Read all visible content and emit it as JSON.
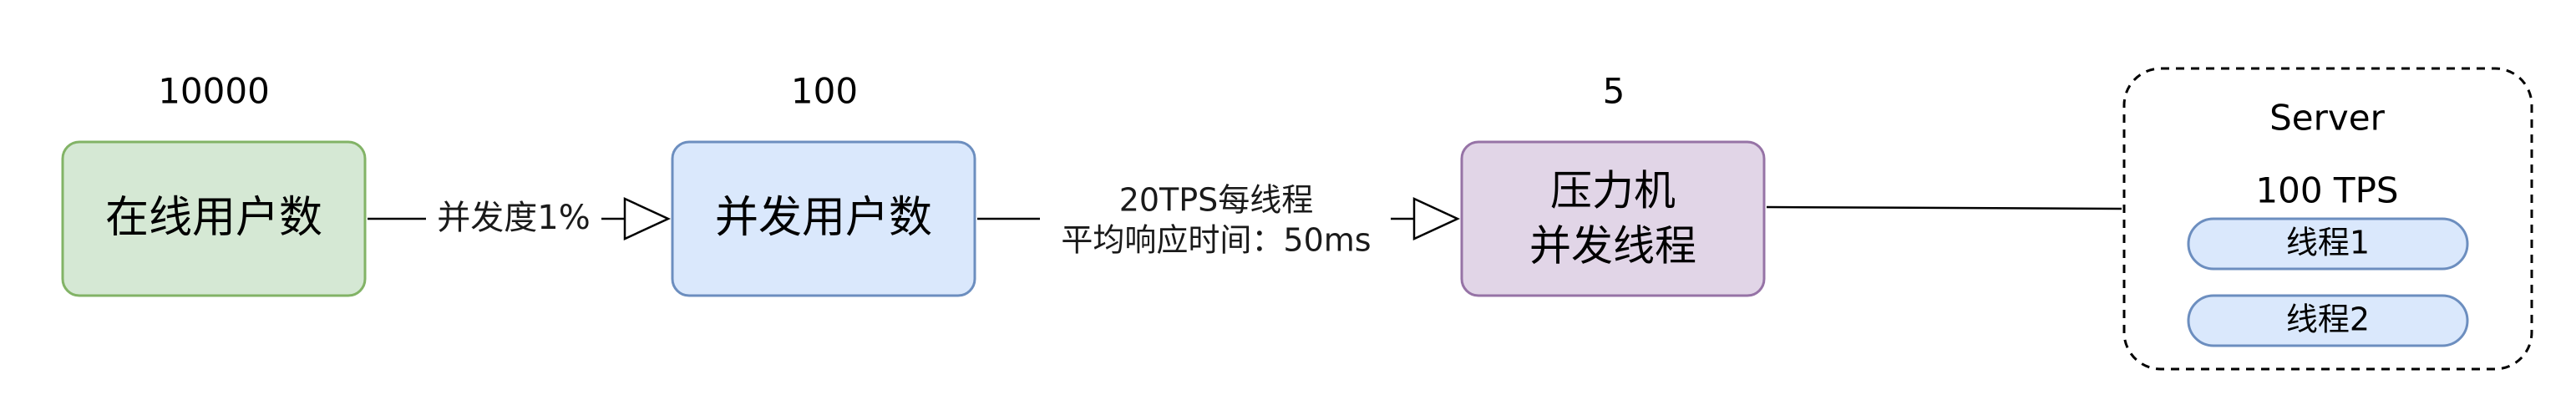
{
  "nodes": {
    "online_users": {
      "label": "在线用户数",
      "count": "10000",
      "fill": "#d5e8d4",
      "stroke": "#82b366"
    },
    "concurrent_users": {
      "label": "并发用户数",
      "count": "100",
      "fill": "#dae8fc",
      "stroke": "#6c8ebf"
    },
    "load_threads": {
      "label_line1": "压力机",
      "label_line2": "并发线程",
      "count": "5",
      "fill": "#e1d5e7",
      "stroke": "#9673a6"
    },
    "server": {
      "title": "Server",
      "tps": "100 TPS",
      "threads": [
        "线程1",
        "线程2"
      ],
      "thread_fill": "#dae8fc",
      "thread_stroke": "#6c8ebf"
    }
  },
  "edges": {
    "concurrency_rate": "并发度1%",
    "per_thread_tps": "20TPS每线程",
    "avg_response": "平均响应时间：50ms"
  }
}
